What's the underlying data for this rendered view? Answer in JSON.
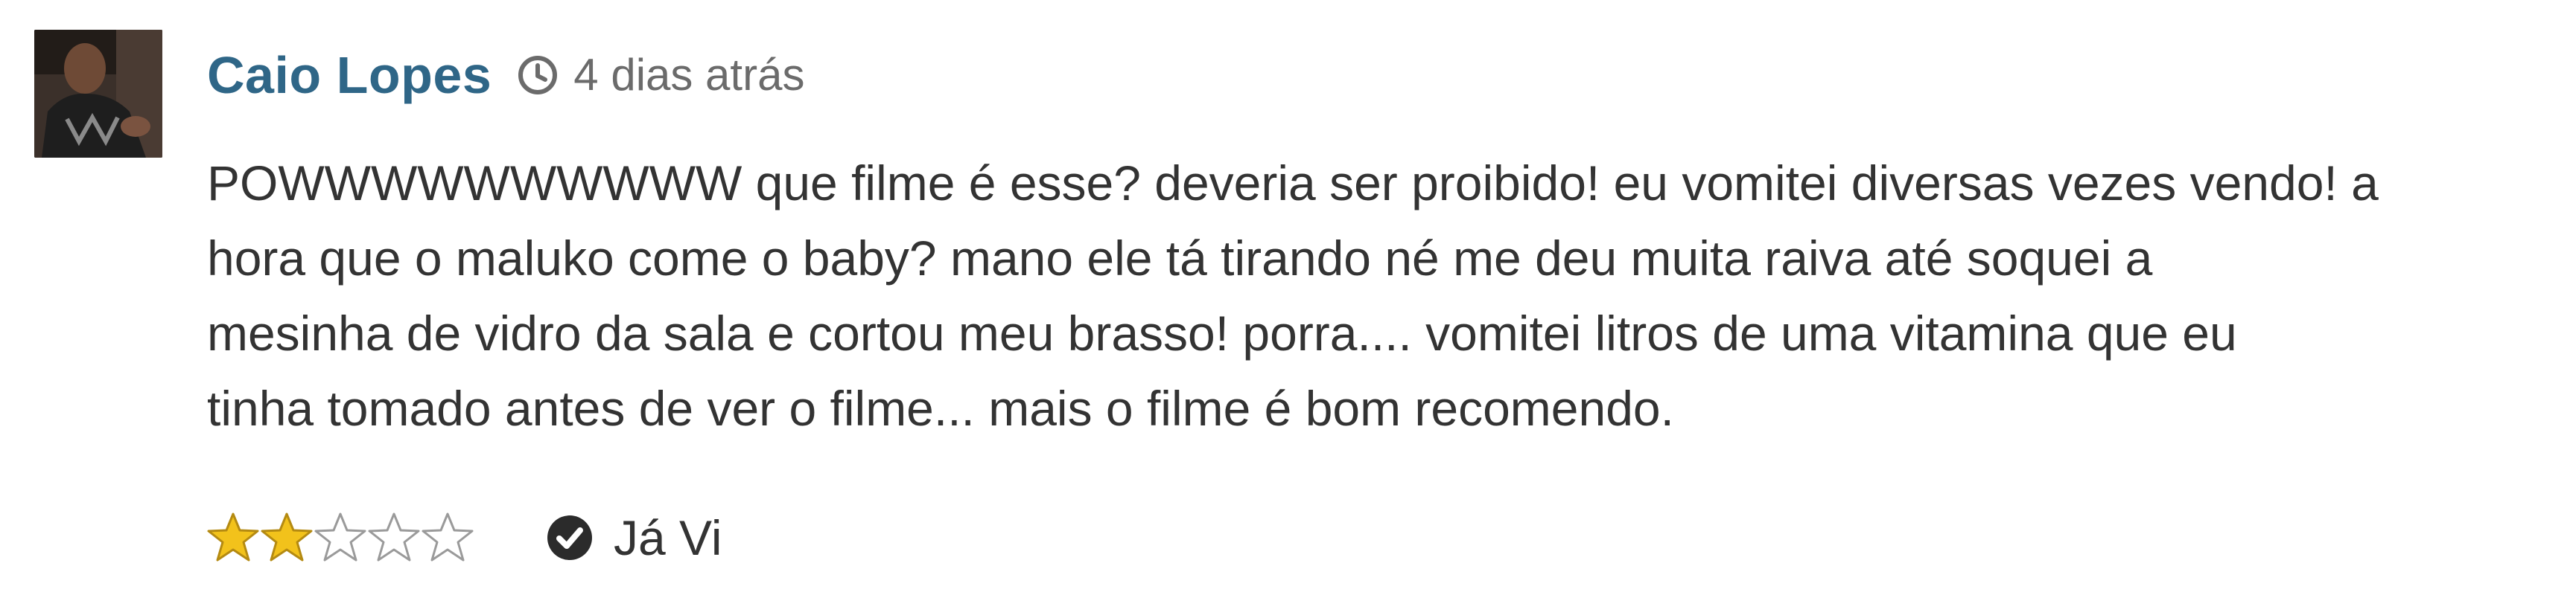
{
  "comment": {
    "author": "Caio Lopes",
    "time_icon": "clock-icon",
    "time_ago": "4 dias atrás",
    "text_lines": [
      "POWWWWWWWWWW que filme é esse? deveria ser proibido! eu vomitei diversas vezes vendo! a",
      "hora que o maluko come o baby? mano ele tá tirando né me deu muita raiva até soquei a",
      "mesinha de vidro da sala e cortou meu brasso! porra.... vomitei litros de uma vitamina que eu",
      "tinha tomado antes de ver o filme... mais o filme é bom recomendo."
    ],
    "rating": {
      "value": 2,
      "max": 5,
      "filled_color": "#f2c21b",
      "empty_color": "#ffffff"
    },
    "seen": {
      "icon": "check-circle-icon",
      "label": "Já Vi"
    }
  },
  "colors": {
    "author": "#2f6687",
    "time": "#6b6b6b",
    "text": "#333333"
  }
}
